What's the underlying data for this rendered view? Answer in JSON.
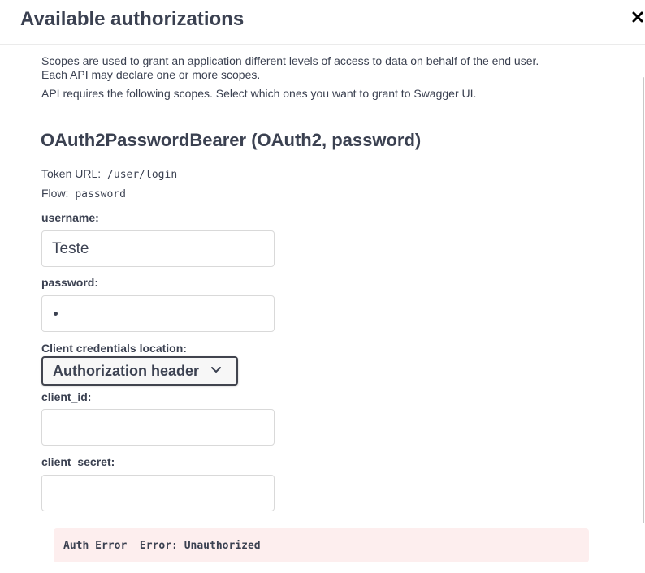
{
  "modal": {
    "title": "Available authorizations",
    "close_icon": "close-icon"
  },
  "description": {
    "line1": "Scopes are used to grant an application different levels of access to data on behalf of the end user.",
    "line2": "Each API may declare one or more scopes.",
    "line3": "API requires the following scopes. Select which ones you want to grant to Swagger UI."
  },
  "scheme": {
    "title": "OAuth2PasswordBearer (OAuth2, password)",
    "token_url_label": "Token URL:",
    "token_url_value": "/user/login",
    "flow_label": "Flow:",
    "flow_value": "password"
  },
  "form": {
    "username_label": "username:",
    "username_value": "Teste",
    "password_label": "password:",
    "password_masked_length": 1,
    "client_location_label": "Client credentials location:",
    "client_location_selected": "Authorization header",
    "client_id_label": "client_id:",
    "client_id_value": "",
    "client_secret_label": "client_secret:",
    "client_secret_value": ""
  },
  "error": {
    "text": "Auth Error  Error: Unauthorized"
  },
  "colors": {
    "text": "#3b4151",
    "error_bg": "#fdeeee",
    "input_border": "#d9d9d9"
  }
}
